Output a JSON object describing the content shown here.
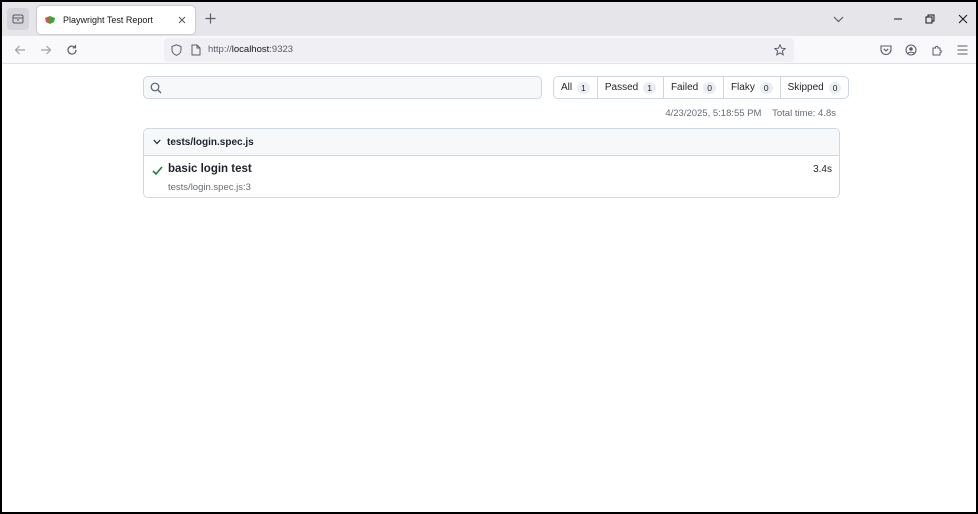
{
  "browser": {
    "tab": {
      "title": "Playwright Test Report"
    },
    "url": {
      "scheme": "http://",
      "host": "localhost",
      "port": ":9323"
    }
  },
  "report": {
    "search": {
      "value": "",
      "placeholder": ""
    },
    "filters": [
      {
        "label": "All",
        "count": "1"
      },
      {
        "label": "Passed",
        "count": "1"
      },
      {
        "label": "Failed",
        "count": "0"
      },
      {
        "label": "Flaky",
        "count": "0"
      },
      {
        "label": "Skipped",
        "count": "0"
      }
    ],
    "timestamp": "4/23/2025, 5:18:55 PM",
    "total_time": "Total time: 4.8s",
    "files": [
      {
        "name": "tests/login.spec.js",
        "tests": [
          {
            "name": "basic login test",
            "location": "tests/login.spec.js:3",
            "duration": "3.4s",
            "status": "passed"
          }
        ]
      }
    ]
  },
  "colors": {
    "passed": "#1a7f37",
    "accent": "#0969da"
  }
}
